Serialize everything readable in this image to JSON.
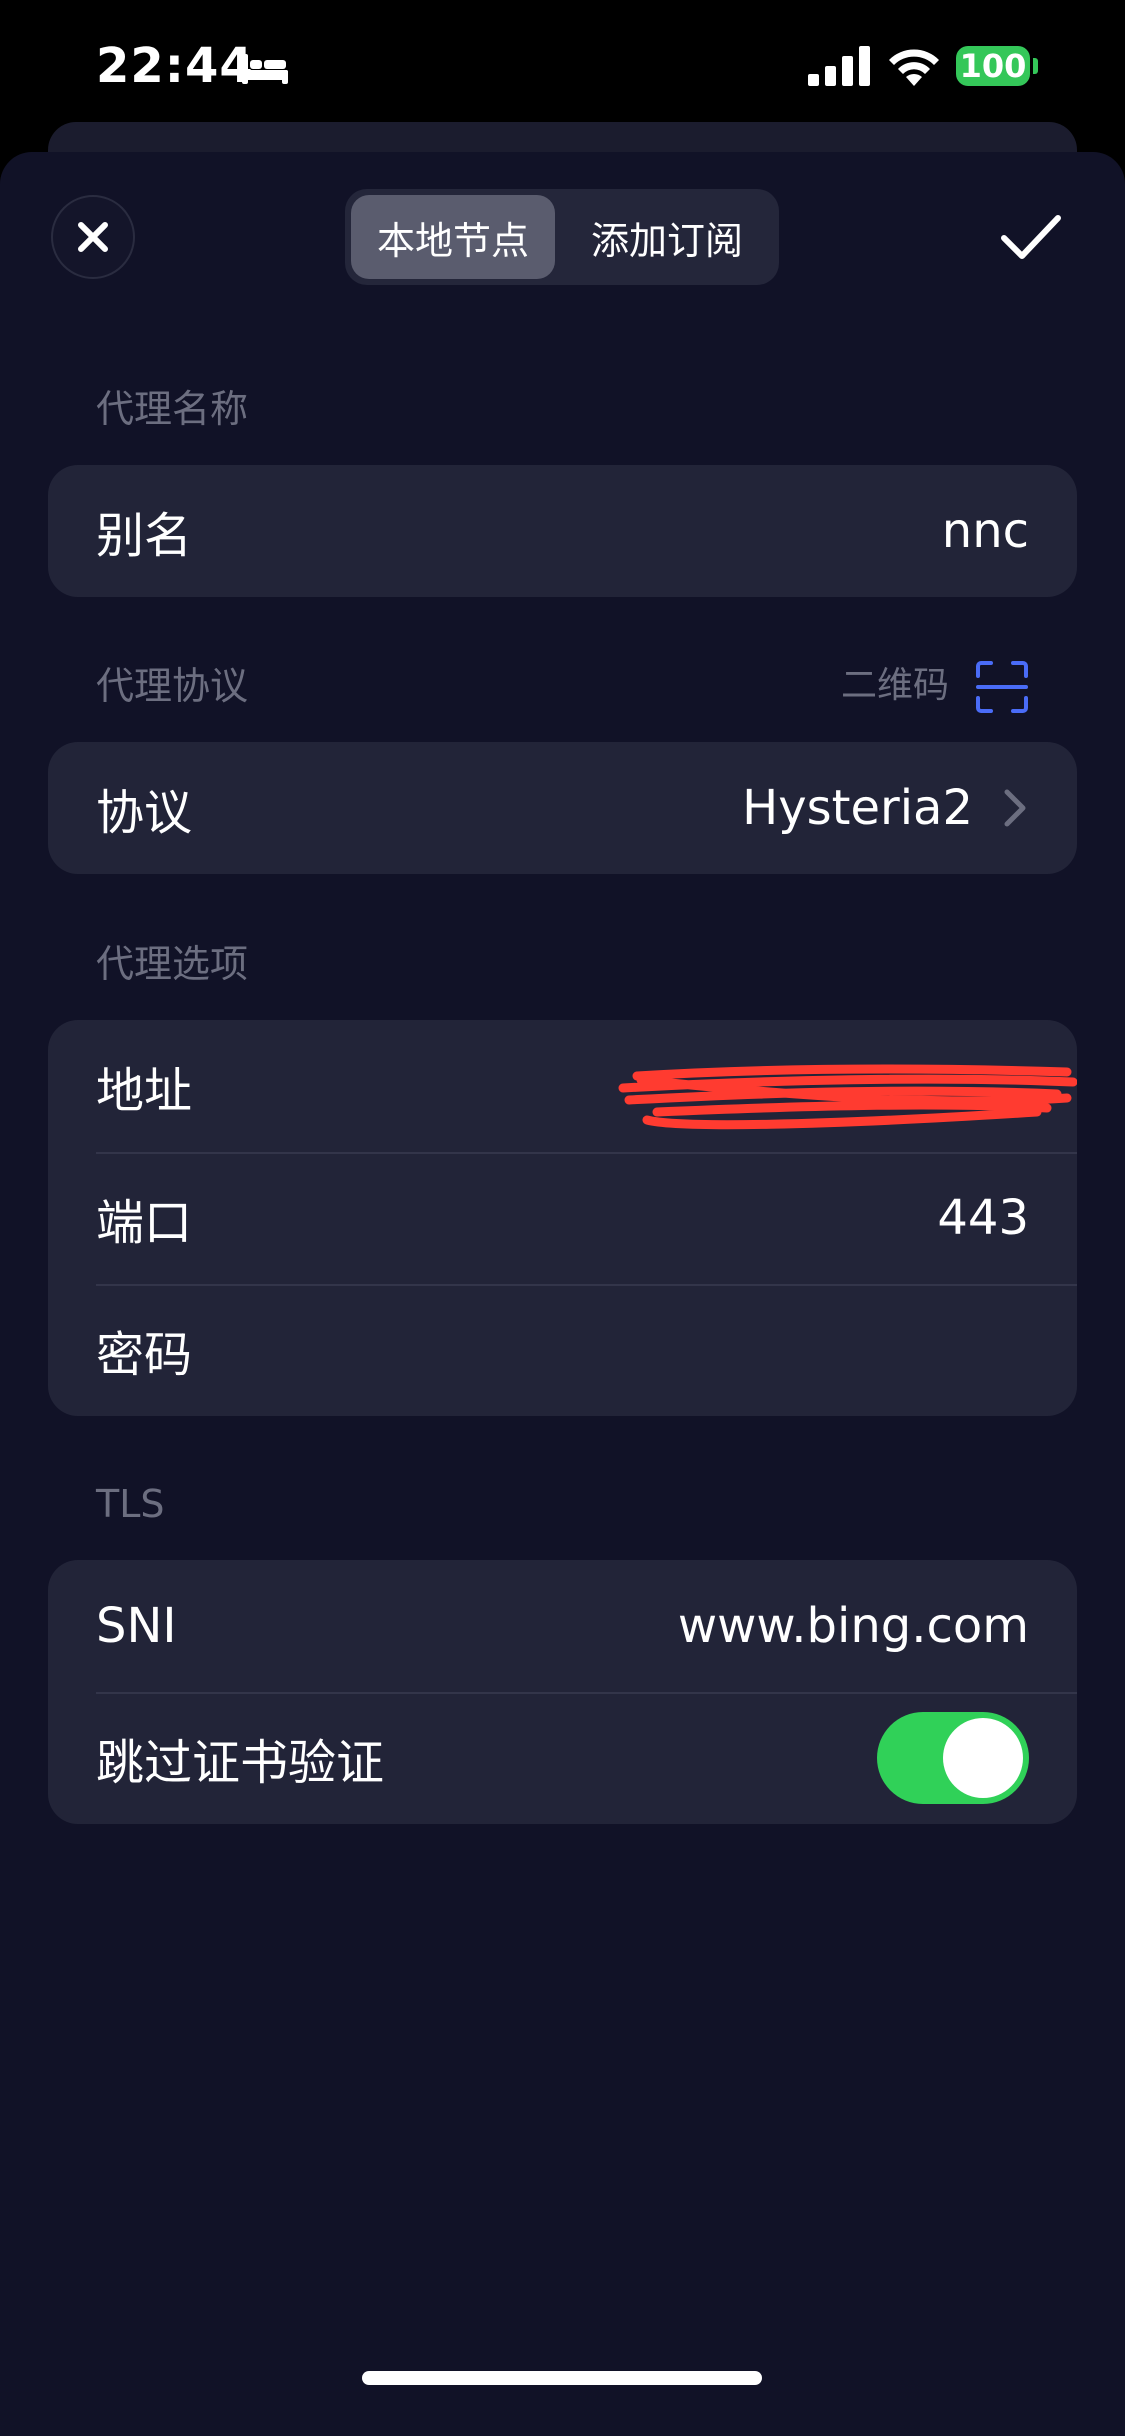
{
  "status_bar": {
    "time": "22:44",
    "battery": "100",
    "icons": [
      "bed-icon",
      "cellular-signal-icon",
      "wifi-icon",
      "battery-icon"
    ]
  },
  "header": {
    "tabs": [
      {
        "label": "本地节点",
        "active": true
      },
      {
        "label": "添加订阅",
        "active": false
      }
    ],
    "close_icon": "close-icon",
    "confirm_icon": "checkmark-icon"
  },
  "sections": {
    "name": {
      "label": "代理名称",
      "rows": [
        {
          "label": "别名",
          "value": "nnc"
        }
      ]
    },
    "protocol": {
      "label": "代理协议",
      "qr_label": "二维码",
      "rows": [
        {
          "label": "协议",
          "value": "Hysteria2"
        }
      ]
    },
    "options": {
      "label": "代理选项",
      "rows": [
        {
          "label": "地址",
          "value": ""
        },
        {
          "label": "端口",
          "value": "443"
        },
        {
          "label": "密码",
          "value": ""
        }
      ]
    },
    "tls": {
      "label": "TLS",
      "rows": [
        {
          "label": "SNI",
          "value": "www.bing.com"
        },
        {
          "label": "跳过证书验证",
          "toggle_on": true
        }
      ]
    }
  },
  "colors": {
    "background": "#111227",
    "card": "#222438",
    "accent_green": "#30d158",
    "accent_blue": "#4a6cf7",
    "redaction": "#ff3b30"
  }
}
